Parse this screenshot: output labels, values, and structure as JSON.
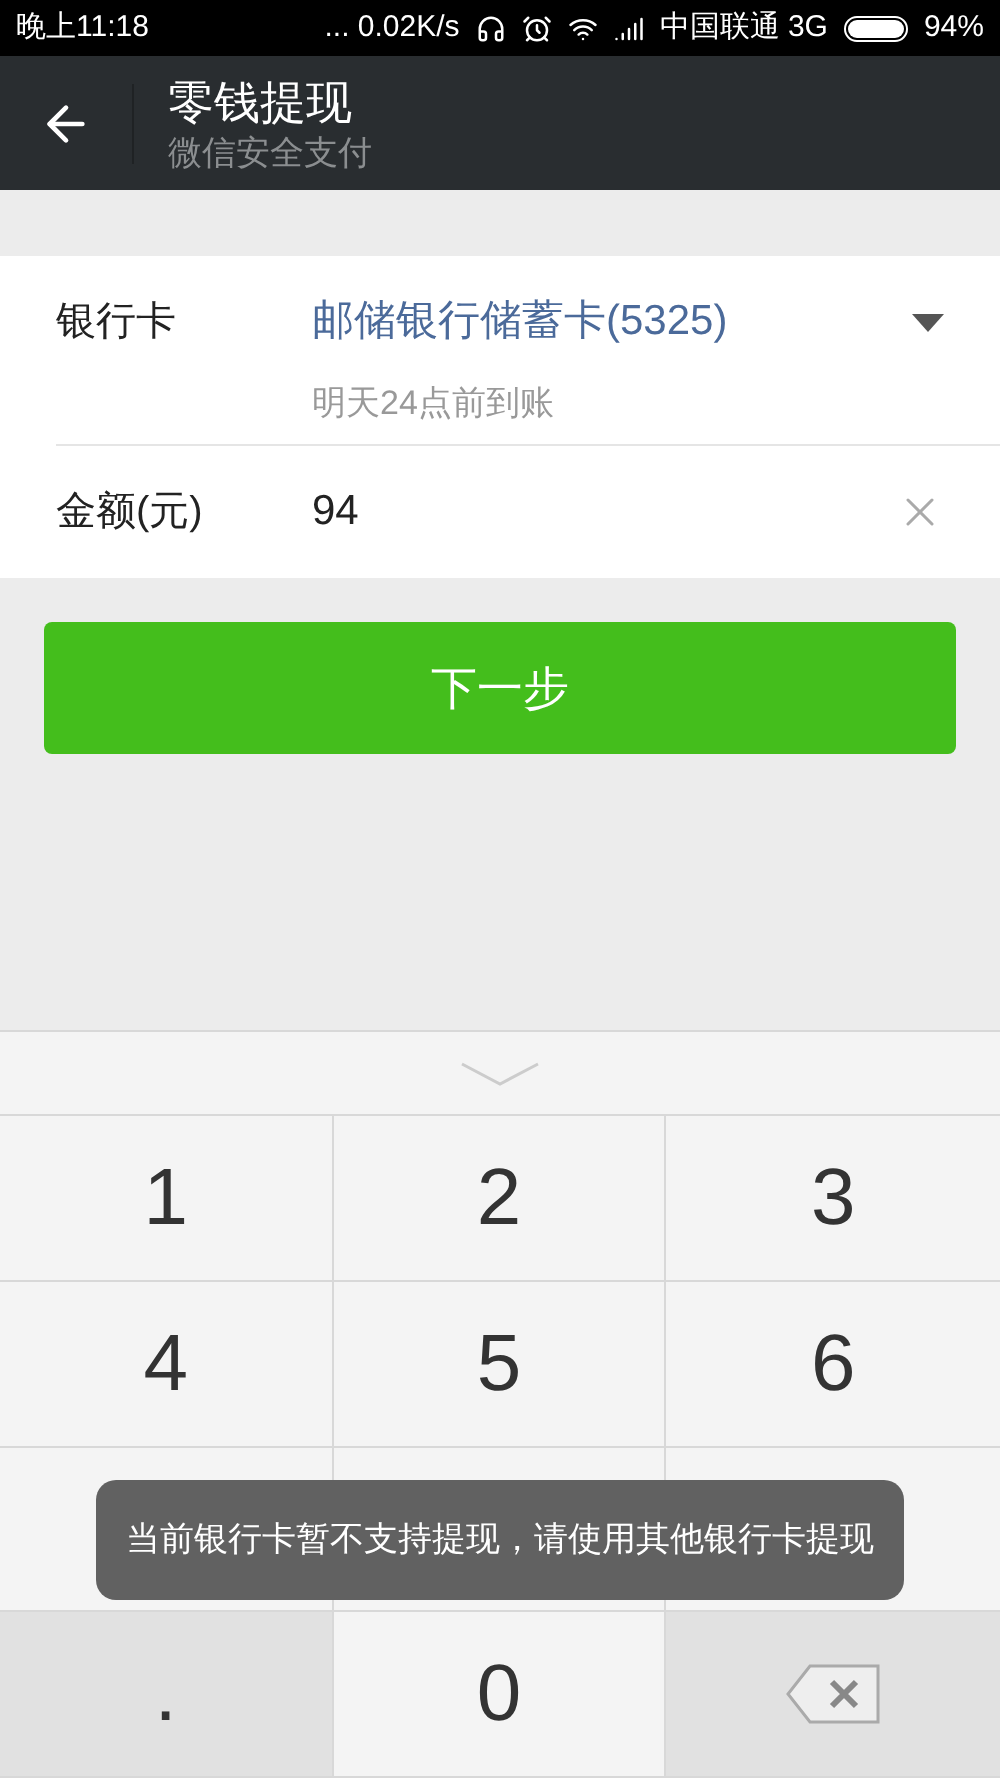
{
  "status_bar": {
    "time": "晚上11:18",
    "speed": "... 0.02K/s",
    "carrier": "中国联通 3G",
    "battery": "94%"
  },
  "header": {
    "title": "零钱提现",
    "subtitle": "微信安全支付"
  },
  "form": {
    "bank_label": "银行卡",
    "bank_value": "邮储银行储蓄卡(5325)",
    "bank_hint": "明天24点前到账",
    "amount_label": "金额(元)",
    "amount_value": "94"
  },
  "next_button": "下一步",
  "keypad": [
    {
      "label": "1",
      "kind": "digit"
    },
    {
      "label": "2",
      "kind": "digit"
    },
    {
      "label": "3",
      "kind": "digit"
    },
    {
      "label": "4",
      "kind": "digit"
    },
    {
      "label": "5",
      "kind": "digit"
    },
    {
      "label": "6",
      "kind": "digit"
    },
    {
      "kind": "digit"
    },
    {
      "kind": "digit"
    },
    {
      "kind": "digit"
    },
    {
      "label": ".",
      "kind": "dot"
    },
    {
      "label": "0",
      "kind": "digit"
    },
    {
      "kind": "delete"
    }
  ],
  "toast": "当前银行卡暂不支持提现，请使用其他银行卡提现"
}
